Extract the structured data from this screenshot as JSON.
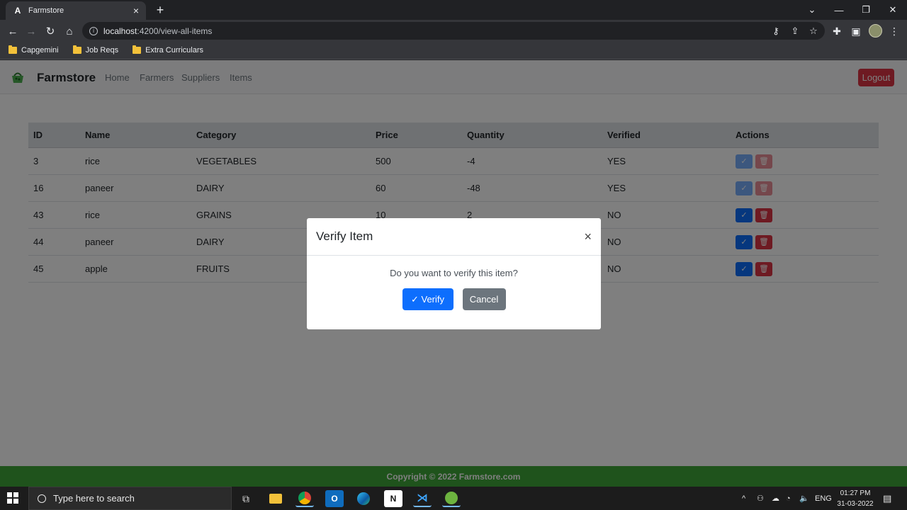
{
  "browser": {
    "tab_title": "Farmstore",
    "tab_favicon": "A",
    "url_host": "localhost",
    "url_path": ":4200/view-all-items",
    "bookmarks": [
      {
        "label": "Capgemini"
      },
      {
        "label": "Job Reqs"
      },
      {
        "label": "Extra Curriculars"
      }
    ]
  },
  "navbar": {
    "brand": "Farmstore",
    "links": [
      "Home",
      "Farmers",
      "Suppliers",
      "Items"
    ],
    "logout_label": "Logout"
  },
  "table": {
    "headers": [
      "ID",
      "Name",
      "Category",
      "Price",
      "Quantity",
      "Verified",
      "Actions"
    ],
    "rows": [
      {
        "id": "3",
        "name": "rice",
        "category": "VEGETABLES",
        "price": "500",
        "quantity": "-4",
        "verified": "YES"
      },
      {
        "id": "16",
        "name": "paneer",
        "category": "DAIRY",
        "price": "60",
        "quantity": "-48",
        "verified": "YES"
      },
      {
        "id": "43",
        "name": "rice",
        "category": "GRAINS",
        "price": "10",
        "quantity": "2",
        "verified": "NO"
      },
      {
        "id": "44",
        "name": "paneer",
        "category": "DAIRY",
        "price": "",
        "quantity": "",
        "verified": "NO"
      },
      {
        "id": "45",
        "name": "apple",
        "category": "FRUITS",
        "price": "",
        "quantity": "",
        "verified": "NO"
      }
    ]
  },
  "footer": {
    "text": "Copyright © 2022 Farmstore.com"
  },
  "modal": {
    "title": "Verify Item",
    "close": "×",
    "message": "Do you want to verify this item?",
    "verify_label": "✓ Verify",
    "cancel_label": "Cancel"
  },
  "taskbar": {
    "search_placeholder": "Type here to search",
    "language": "ENG",
    "time": "01:27 PM",
    "date": "31-03-2022"
  },
  "colors": {
    "primary": "#0d6efd",
    "danger": "#dc3545",
    "secondary": "#6c757d",
    "footer_green": "#3ea639"
  }
}
